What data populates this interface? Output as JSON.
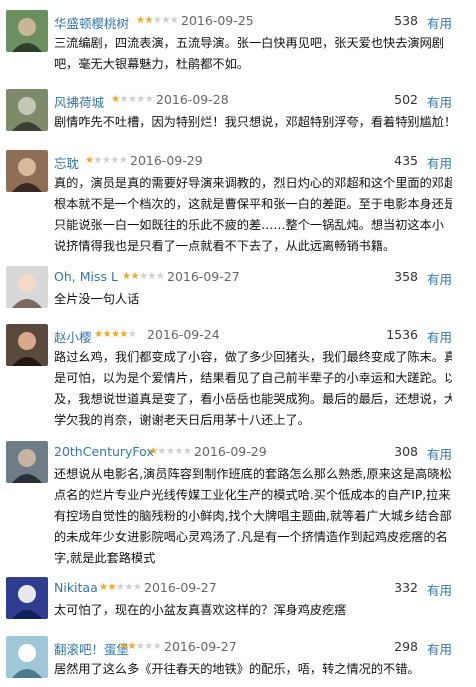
{
  "reviews": [
    {
      "user": "华盛顿樱桃树",
      "rating": 2,
      "date": "2016-09-25",
      "votes": "538",
      "useful_label": "有用",
      "avatar": "avatar-icon",
      "lines": [
        "三流编剧，四流表演，五流导演。张一白快再见吧，张天爱也快去演网剧",
        "吧，毫无大银幕魅力，杜鹃都不如。"
      ]
    },
    {
      "user": "风拂荷城",
      "rating": 1,
      "date": "2016-09-28",
      "votes": "502",
      "useful_label": "有用",
      "avatar": "avatar-icon",
      "lines": [
        "剧情咋先不吐槽，因为特别烂！我只想说，邓超特别浮夸，看着特别尴尬！"
      ]
    },
    {
      "user": "忘耽",
      "rating": 1,
      "date": "2016-09-29",
      "votes": "435",
      "useful_label": "有用",
      "avatar": "avatar-icon",
      "lines": [
        "真的，演员是真的需要好导演来调教的，烈日灼心的邓超和这个里面的邓超",
        "根本就不是一个档次的，这就是曹保平和张一白的差距。至于电影本身还是",
        "只能说张一白一如既往的乐此不疲的差……整个一锅乱炖。想当初这本小",
        "说挤情得我也是只看了一点就看不下去了，从此远离畅销书籍。"
      ]
    },
    {
      "user": "Oh, Miss L",
      "rating": 2,
      "date": "2016-09-27",
      "votes": "358",
      "useful_label": "有用",
      "avatar": "avatar-icon",
      "lines": [
        "全片没一句人话"
      ]
    },
    {
      "user": "赵小樱",
      "rating": 4,
      "date": "2016-09-24",
      "votes": "1536",
      "useful_label": "有用",
      "avatar": "avatar-icon",
      "lines": [
        "路过幺鸡，我们都变成了小容，做了多少回猪头，我们最终变成了陈末。真",
        "是可怕，以为是个爱情片，结果看见了自己前半辈子的小幸运和大蹉跎。以",
        "及，我想说世道真是变了，看小岳岳也能哭成狗。最后的最后，还想说，大",
        "学欠我的肖奈，谢谢老天日后用茅十八还上了。"
      ]
    },
    {
      "user": "20thCenturyFox",
      "rating": 1,
      "date": "2016-09-29",
      "votes": "308",
      "useful_label": "有用",
      "avatar": "avatar-icon",
      "lines": [
        "还想说从电影名,演员阵容到制作班底的套路怎么那么熟悉,原来这是高晓松",
        "点名的烂片专业户光线传媒工业化生产的模式哈.买个低成本的自产IP,拉来",
        "有控场自觉性的脑残粉的小鲜肉,找个大牌唱主题曲,就等着广大城乡结合部",
        "的未成年少女进影院喝心灵鸡汤了.凡是有一个挤情造作到起鸡皮疙瘩的名",
        "字,就是此套路模式"
      ]
    },
    {
      "user": "Nikitaa",
      "rating": 2,
      "date": "2016-09-27",
      "votes": "332",
      "useful_label": "有用",
      "avatar": "avatar-icon",
      "lines": [
        "太可怕了，现在的小盆友真喜欢这样的？浑身鸡皮疙瘩"
      ]
    },
    {
      "user": "翻滚吧！蛋堡",
      "rating": 2,
      "date": "2016-09-27",
      "votes": "298",
      "useful_label": "有用",
      "avatar": "avatar-icon",
      "lines": [
        "居然用了这么多《开往春天的地铁》的配乐，唔，转之情况的不错。"
      ]
    }
  ],
  "star_full": "★",
  "star_empty": "★",
  "colors": {
    "link": "#3377aa",
    "star": "#f5a623"
  }
}
